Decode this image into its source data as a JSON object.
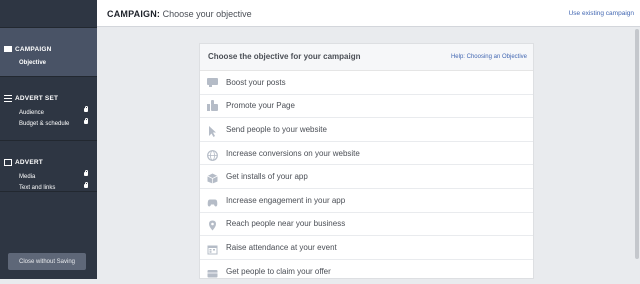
{
  "sidebar": {
    "sections": [
      {
        "title": "CAMPAIGN",
        "icon": "campaign-icon",
        "items": [
          {
            "label": "Objective",
            "locked": false
          }
        ]
      },
      {
        "title": "ADVERT SET",
        "icon": "advert-set-icon",
        "items": [
          {
            "label": "Audience",
            "locked": true
          },
          {
            "label": "Budget & schedule",
            "locked": true
          }
        ]
      },
      {
        "title": "ADVERT",
        "icon": "advert-icon",
        "items": [
          {
            "label": "Media",
            "locked": true
          },
          {
            "label": "Text and links",
            "locked": true
          }
        ]
      }
    ],
    "close_button": "Close without Saving"
  },
  "header": {
    "title_bold": "CAMPAIGN:",
    "title_rest": " Choose your objective",
    "use_existing": "Use existing campaign"
  },
  "card": {
    "title": "Choose the objective for your campaign",
    "help_link": "Help: Choosing an Objective",
    "objectives": [
      {
        "label": "Boost your posts",
        "icon": "speech-bubble-icon"
      },
      {
        "label": "Promote your Page",
        "icon": "thumbs-up-icon"
      },
      {
        "label": "Send people to your website",
        "icon": "cursor-icon"
      },
      {
        "label": "Increase conversions on your website",
        "icon": "globe-icon"
      },
      {
        "label": "Get installs of your app",
        "icon": "box-icon"
      },
      {
        "label": "Increase engagement in your app",
        "icon": "gamepad-icon"
      },
      {
        "label": "Reach people near your business",
        "icon": "location-pin-icon"
      },
      {
        "label": "Raise attendance at your event",
        "icon": "calendar-icon"
      },
      {
        "label": "Get people to claim your offer",
        "icon": "ticket-icon"
      }
    ]
  },
  "colors": {
    "sidebar_bg": "#2e3643",
    "sidebar_active": "#495366",
    "link": "#4267b2",
    "icon_gray": "#b5bcc7"
  }
}
